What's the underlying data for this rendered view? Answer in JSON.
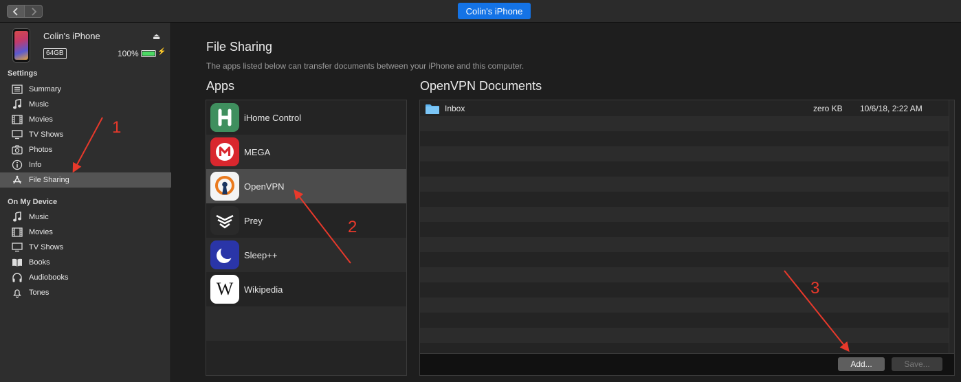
{
  "topbar": {
    "device_pill": "Colin's iPhone"
  },
  "device": {
    "name": "Colin's iPhone",
    "capacity": "64GB",
    "battery_percent": "100%",
    "battery_level": 1.0
  },
  "sidebar": {
    "settings_header": "Settings",
    "settings_items": [
      {
        "label": "Summary",
        "icon": "summary-icon"
      },
      {
        "label": "Music",
        "icon": "music-note-icon"
      },
      {
        "label": "Movies",
        "icon": "film-icon"
      },
      {
        "label": "TV Shows",
        "icon": "tv-icon"
      },
      {
        "label": "Photos",
        "icon": "camera-icon"
      },
      {
        "label": "Info",
        "icon": "info-icon"
      },
      {
        "label": "File Sharing",
        "icon": "app-store-icon",
        "active": true
      }
    ],
    "device_header": "On My Device",
    "device_items": [
      {
        "label": "Music",
        "icon": "music-note-icon"
      },
      {
        "label": "Movies",
        "icon": "film-icon"
      },
      {
        "label": "TV Shows",
        "icon": "tv-icon"
      },
      {
        "label": "Books",
        "icon": "book-icon"
      },
      {
        "label": "Audiobooks",
        "icon": "headphones-icon"
      },
      {
        "label": "Tones",
        "icon": "bell-icon"
      }
    ]
  },
  "main": {
    "title": "File Sharing",
    "description": "The apps listed below can transfer documents between your iPhone and this computer.",
    "apps_title": "Apps",
    "docs_title": "OpenVPN Documents",
    "apps": [
      {
        "name": "iHome Control",
        "icon": "ihome-icon",
        "color": "#3f8f5e"
      },
      {
        "name": "MEGA",
        "icon": "mega-icon",
        "color": "#d9272e"
      },
      {
        "name": "OpenVPN",
        "icon": "openvpn-icon",
        "color": "#f4f4f4",
        "selected": true
      },
      {
        "name": "Prey",
        "icon": "prey-icon",
        "color": "#2a2a2a"
      },
      {
        "name": "Sleep++",
        "icon": "moon-icon",
        "color": "#2a35a8"
      },
      {
        "name": "Wikipedia",
        "icon": "wikipedia-icon",
        "color": "#ffffff"
      }
    ],
    "documents": [
      {
        "name": "Inbox",
        "size": "zero KB",
        "date": "10/6/18, 2:22 AM",
        "icon": "folder-icon"
      }
    ],
    "add_button": "Add...",
    "save_button": "Save..."
  },
  "annotations": {
    "step1": "1",
    "step2": "2",
    "step3": "3",
    "color": "#e8392b"
  },
  "colors": {
    "accent": "#1473e6",
    "battery": "#4cd964"
  }
}
